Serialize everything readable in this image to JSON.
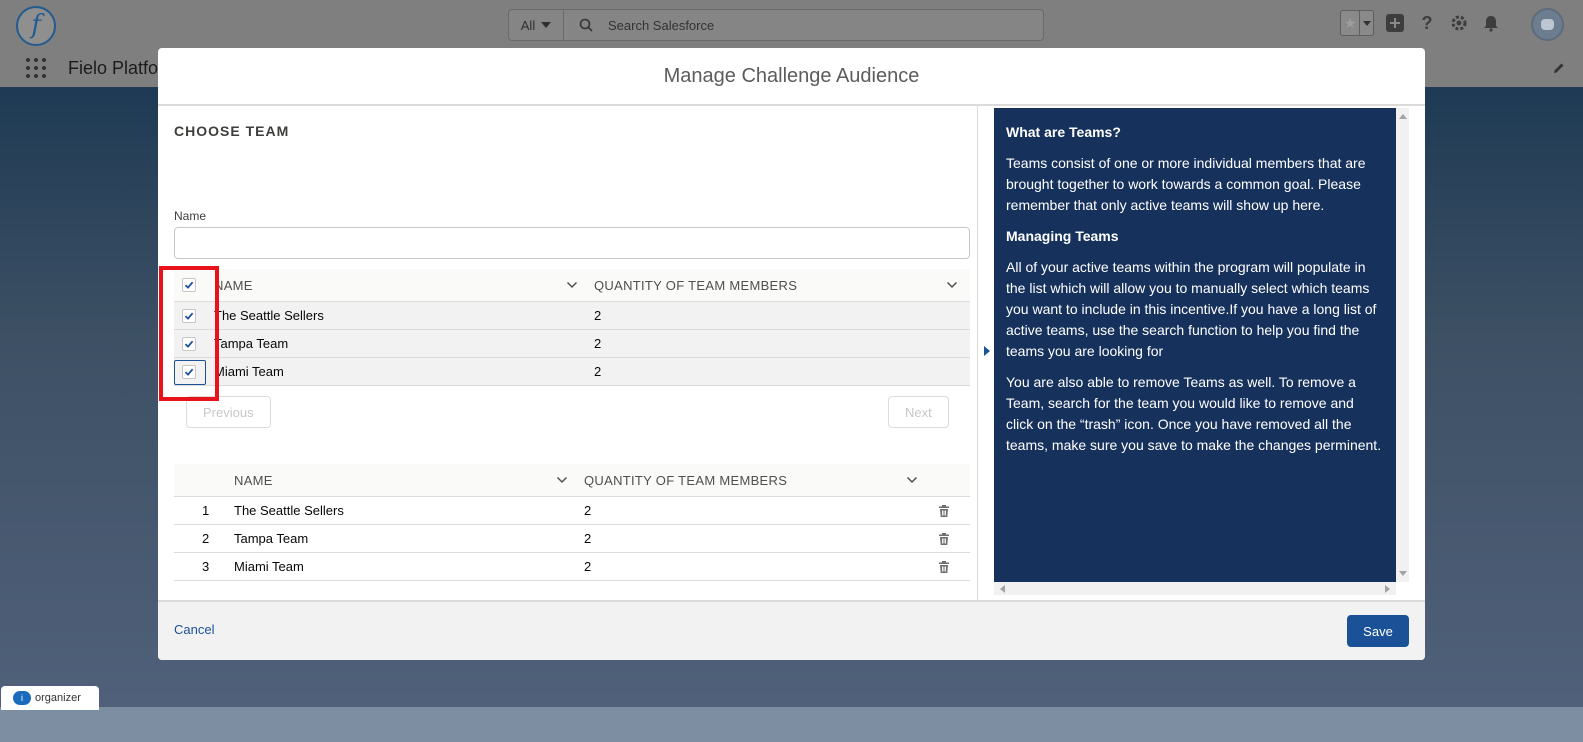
{
  "header": {
    "logo_letter": "f",
    "search_scope": "All",
    "search_placeholder": "Search Salesforce"
  },
  "nav": {
    "app_name": "Fielo Platfo"
  },
  "organizer": {
    "logo_text": "i",
    "label": "organizer"
  },
  "modal": {
    "title": "Manage Challenge Audience",
    "section_title": "CHOOSE TEAM",
    "name_label": "Name",
    "name_value": "",
    "selection_table": {
      "headers": [
        "NAME",
        "QUANTITY OF TEAM MEMBERS"
      ],
      "rows": [
        {
          "name": "The Seattle Sellers",
          "qty": "2",
          "checked": true
        },
        {
          "name": "Tampa Team",
          "qty": "2",
          "checked": true
        },
        {
          "name": "Miami Team",
          "qty": "2",
          "checked": true
        }
      ]
    },
    "pager": {
      "previous": "Previous",
      "next": "Next"
    },
    "selected_table": {
      "headers": [
        "NAME",
        "QUANTITY OF TEAM MEMBERS"
      ],
      "rows": [
        {
          "index": "1",
          "name": "The Seattle Sellers",
          "qty": "2"
        },
        {
          "index": "2",
          "name": "Tampa Team",
          "qty": "2"
        },
        {
          "index": "3",
          "name": "Miami Team",
          "qty": "2"
        }
      ]
    },
    "info": {
      "heading1": "What are Teams?",
      "para1": "Teams consist of one or more individual members that are brought together to work towards a common goal. Please remember that only active teams will show up here.",
      "heading2": "Managing Teams",
      "para2": "All of your active teams within the program will populate in the list which will allow you to manually select which teams you want to include in this incentive.If you have a long list of active teams, use the search function to help you find the teams you are looking for",
      "para3": "You are also able to remove Teams as well. To remove a Team, search for the team you would like to remove and click on the “trash” icon. Once you have removed all the teams, make sure you save to make the changes perminent."
    },
    "footer": {
      "cancel": "Cancel",
      "save": "Save"
    }
  },
  "colors": {
    "brand": "#1b5297",
    "info_panel": "#16325c",
    "highlight": "#e8121b"
  }
}
